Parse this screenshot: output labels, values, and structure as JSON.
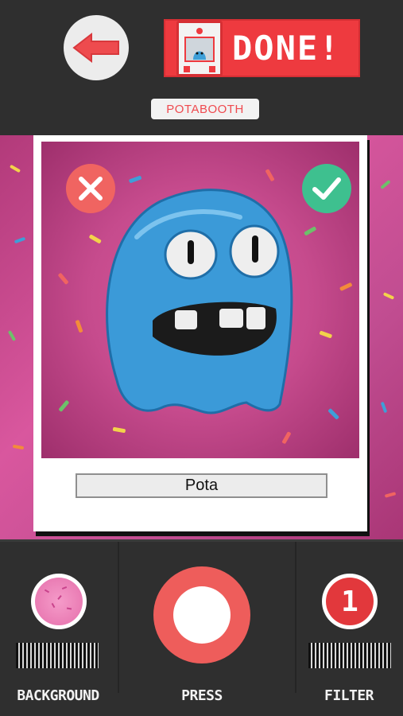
{
  "header": {
    "back_icon": "arrow-left-icon",
    "done_label": "DONE!",
    "done_icon": "photobooth-machine-icon",
    "brand": "POTABOOTH"
  },
  "photo": {
    "subject": "blue-clay-monster",
    "cancel_icon": "close-icon",
    "confirm_icon": "checkmark-icon",
    "name_value": "Pota"
  },
  "controls": {
    "background_label": "BACKGROUND",
    "press_label": "PRESS",
    "filter_label": "FILTER",
    "filter_number": "1",
    "shutter_icon": "shutter-icon",
    "background_icon": "background-swatch-icon"
  },
  "colors": {
    "accent_red": "#ee3a3f",
    "confirm_green": "#3ec08f",
    "cancel_red": "#f06461",
    "background_pink": "#c64b8d",
    "toolbar_dark": "#2f2f2f"
  }
}
